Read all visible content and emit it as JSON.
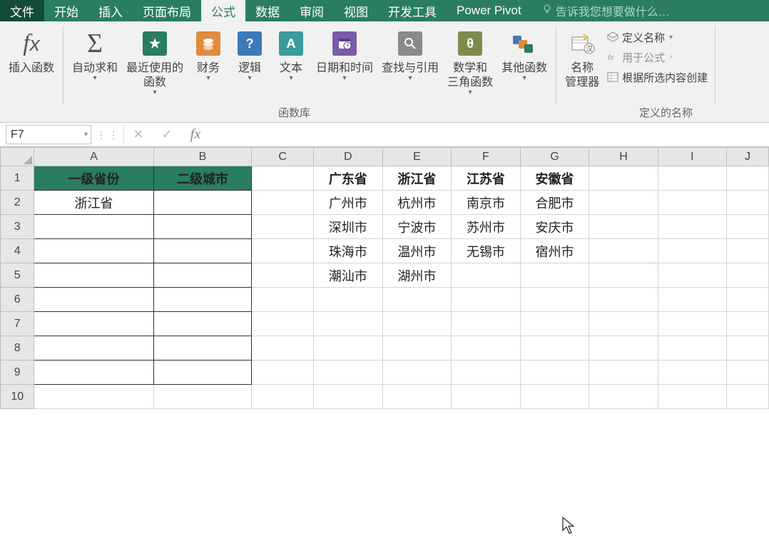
{
  "tabs": {
    "file": "文件",
    "home": "开始",
    "insert": "插入",
    "layout": "页面布局",
    "formula": "公式",
    "data": "数据",
    "review": "审阅",
    "view": "视图",
    "dev": "开发工具",
    "pivot": "Power Pivot",
    "tell": "告诉我您想要做什么…"
  },
  "ribbon": {
    "insertfn": "插入函数",
    "autosum": "自动求和",
    "recent": "最近使用的\n函数",
    "financial": "财务",
    "logical": "逻辑",
    "text": "文本",
    "datetime": "日期和时间",
    "lookup": "查找与引用",
    "math": "数学和\n三角函数",
    "more": "其他函数",
    "namemgr": "名称\n管理器",
    "define": "定义名称",
    "usein": "用于公式",
    "fromsel": "根据所选内容创建",
    "group_lib": "函数库",
    "group_names": "定义的名称",
    "dd": "▾"
  },
  "fbar": {
    "ref": "F7",
    "dots": "⋮⋮",
    "x": "✕",
    "chk": "✓",
    "fx": "fx",
    "val": ""
  },
  "cols": [
    "A",
    "B",
    "C",
    "D",
    "E",
    "F",
    "G",
    "H",
    "I",
    "J"
  ],
  "rows": [
    "1",
    "2",
    "3",
    "4",
    "5",
    "6",
    "7",
    "8",
    "9",
    "10"
  ],
  "hdr": {
    "a": "一级省份",
    "b": "二级城市"
  },
  "a2": "浙江省",
  "prov": {
    "d": "广东省",
    "e": "浙江省",
    "f": "江苏省",
    "g": "安徽省"
  },
  "city": {
    "d": [
      "广州市",
      "深圳市",
      "珠海市",
      "潮汕市"
    ],
    "e": [
      "杭州市",
      "宁波市",
      "温州市",
      "湖州市"
    ],
    "f": [
      "南京市",
      "苏州市",
      "无锡市",
      ""
    ],
    "g": [
      "合肥市",
      "安庆市",
      "宿州市",
      ""
    ]
  },
  "colw": {
    "A": 170,
    "B": 140,
    "C": 88,
    "D": 98,
    "E": 98,
    "F": 98,
    "G": 98,
    "H": 98,
    "I": 98,
    "J": 60
  },
  "colors": {
    "brand": "#2a7d5f"
  }
}
